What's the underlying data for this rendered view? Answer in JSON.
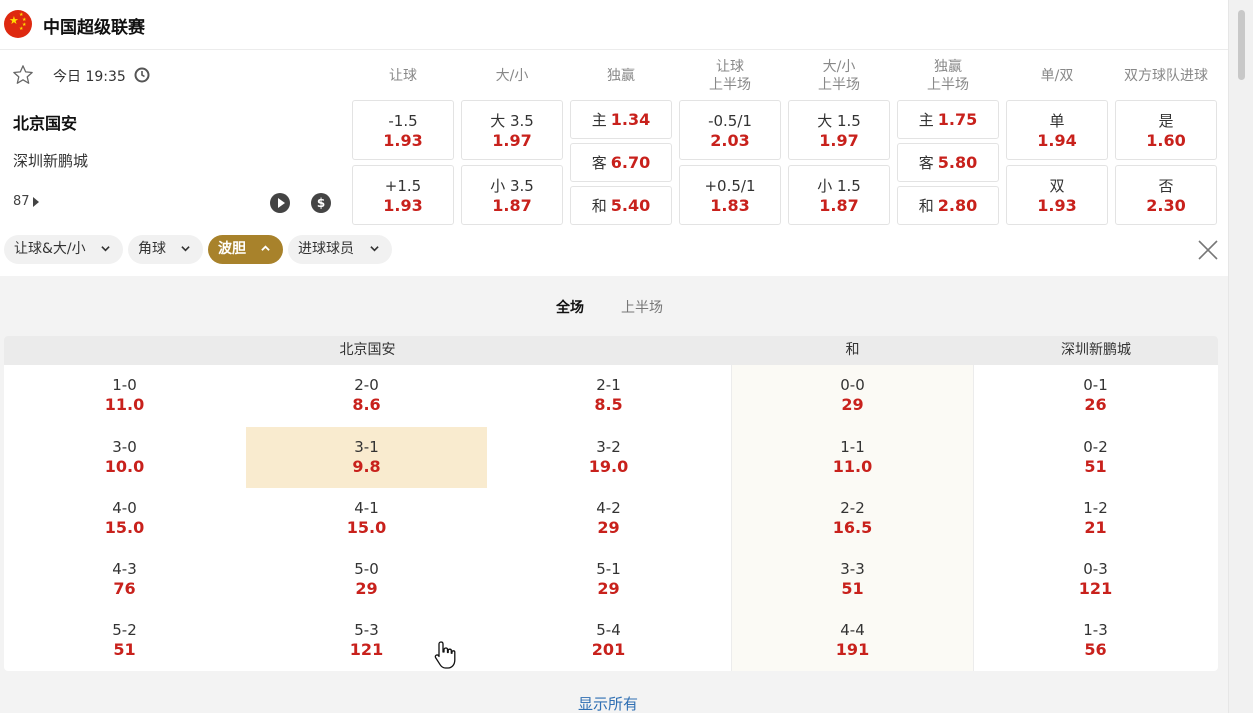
{
  "league": {
    "title": "中国超级联赛",
    "flag_icon": "china-flag-icon"
  },
  "match": {
    "time": "今日 19:35",
    "home": "北京国安",
    "away": "深圳新鹏城",
    "more_count": "87"
  },
  "markets": {
    "headers": [
      {
        "l1": "让球",
        "l2": ""
      },
      {
        "l1": "大/小",
        "l2": ""
      },
      {
        "l1": "独赢",
        "l2": ""
      },
      {
        "l1": "让球",
        "l2": "上半场"
      },
      {
        "l1": "大/小",
        "l2": "上半场"
      },
      {
        "l1": "独赢",
        "l2": "上半场"
      },
      {
        "l1": "单/双",
        "l2": ""
      },
      {
        "l1": "双方球队进球",
        "l2": ""
      }
    ],
    "handicap": [
      {
        "label": "-1.5",
        "odd": "1.93"
      },
      {
        "label": "+1.5",
        "odd": "1.93"
      }
    ],
    "overunder": [
      {
        "label": "大 3.5",
        "odd": "1.97"
      },
      {
        "label": "小 3.5",
        "odd": "1.87"
      }
    ],
    "moneyline": [
      {
        "label": "主",
        "odd": "1.34"
      },
      {
        "label": "客",
        "odd": "6.70"
      },
      {
        "label": "和",
        "odd": "5.40"
      }
    ],
    "handicap_1h": [
      {
        "label": "-0.5/1",
        "odd": "2.03"
      },
      {
        "label": "+0.5/1",
        "odd": "1.83"
      }
    ],
    "overunder_1h": [
      {
        "label": "大 1.5",
        "odd": "1.97"
      },
      {
        "label": "小 1.5",
        "odd": "1.87"
      }
    ],
    "moneyline_1h": [
      {
        "label": "主",
        "odd": "1.75"
      },
      {
        "label": "客",
        "odd": "5.80"
      },
      {
        "label": "和",
        "odd": "2.80"
      }
    ],
    "oddeven": [
      {
        "label": "单",
        "odd": "1.94"
      },
      {
        "label": "双",
        "odd": "1.93"
      }
    ],
    "btts": [
      {
        "label": "是",
        "odd": "1.60"
      },
      {
        "label": "否",
        "odd": "2.30"
      }
    ]
  },
  "filters": [
    {
      "label": "让球&大/小",
      "active": false
    },
    {
      "label": "角球",
      "active": false
    },
    {
      "label": "波胆",
      "active": true
    },
    {
      "label": "进球球员",
      "active": false
    }
  ],
  "correct_score": {
    "tabs": {
      "full": "全场",
      "half": "上半场"
    },
    "headers": {
      "home": "北京国安",
      "draw": "和",
      "away": "深圳新鹏城"
    },
    "home": [
      [
        {
          "score": "1-0",
          "odd": "11.0"
        },
        {
          "score": "2-0",
          "odd": "8.6"
        },
        {
          "score": "2-1",
          "odd": "8.5"
        }
      ],
      [
        {
          "score": "3-0",
          "odd": "10.0"
        },
        {
          "score": "3-1",
          "odd": "9.8"
        },
        {
          "score": "3-2",
          "odd": "19.0"
        }
      ],
      [
        {
          "score": "4-0",
          "odd": "15.0"
        },
        {
          "score": "4-1",
          "odd": "15.0"
        },
        {
          "score": "4-2",
          "odd": "29"
        }
      ],
      [
        {
          "score": "4-3",
          "odd": "76"
        },
        {
          "score": "5-0",
          "odd": "29"
        },
        {
          "score": "5-1",
          "odd": "29"
        }
      ],
      [
        {
          "score": "5-2",
          "odd": "51"
        },
        {
          "score": "5-3",
          "odd": "121"
        },
        {
          "score": "5-4",
          "odd": "201"
        }
      ]
    ],
    "draw": [
      {
        "score": "0-0",
        "odd": "29"
      },
      {
        "score": "1-1",
        "odd": "11.0"
      },
      {
        "score": "2-2",
        "odd": "16.5"
      },
      {
        "score": "3-3",
        "odd": "51"
      },
      {
        "score": "4-4",
        "odd": "191"
      }
    ],
    "away": [
      {
        "score": "0-1",
        "odd": "26"
      },
      {
        "score": "0-2",
        "odd": "51"
      },
      {
        "score": "1-2",
        "odd": "21"
      },
      {
        "score": "0-3",
        "odd": "121"
      },
      {
        "score": "1-3",
        "odd": "56"
      }
    ],
    "show_all": "显示所有"
  },
  "colors": {
    "odds": "#c8211c",
    "active_filter": "#a8822b",
    "highlight": "#f9ebcf",
    "link": "#2f6fb3"
  }
}
